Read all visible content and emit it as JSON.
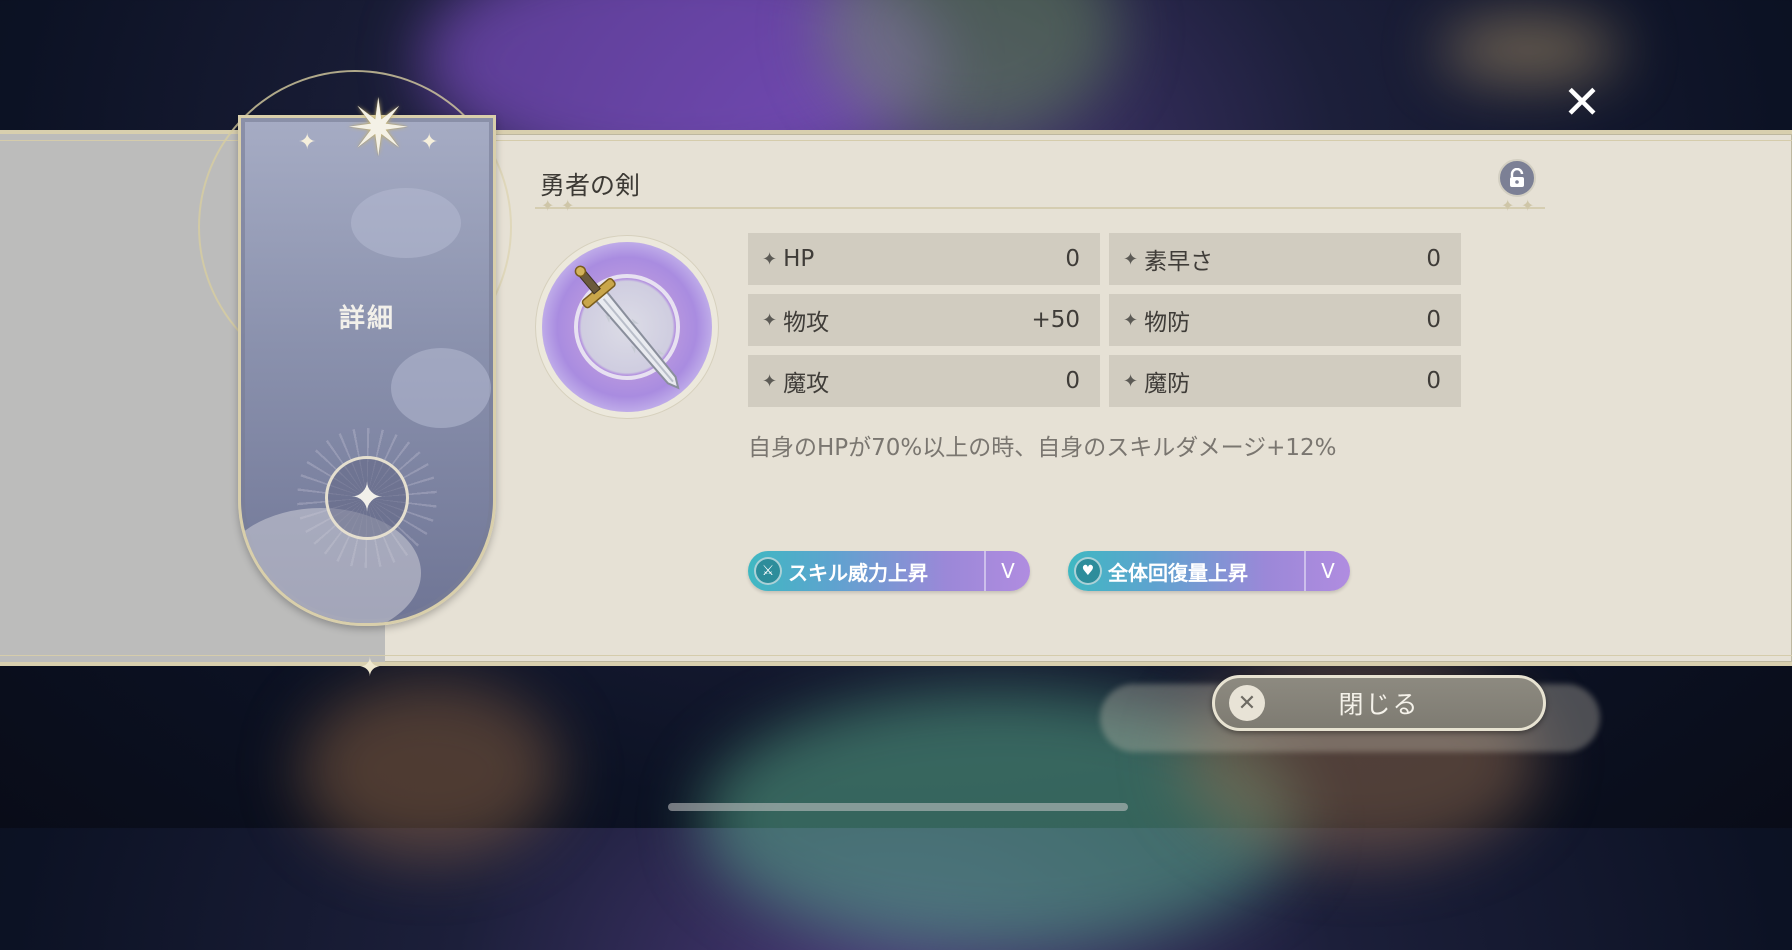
{
  "header": {
    "close_icon": "close-icon",
    "blurred_currency_present": true
  },
  "side_card": {
    "title": "詳細",
    "icons": [
      "eight-point-star-icon",
      "four-point-star-icon",
      "sparkle-icon"
    ]
  },
  "item": {
    "name": "勇者の剣",
    "lock_icon": "unlocked-padlock-icon",
    "image_icon": "sword-icon",
    "description": "自身のHPが70%以上の時、自身のスキルダメージ+12%"
  },
  "stats": [
    {
      "label": "HP",
      "value": "0"
    },
    {
      "label": "素早さ",
      "value": "0"
    },
    {
      "label": "物攻",
      "value": "+50"
    },
    {
      "label": "物防",
      "value": "0"
    },
    {
      "label": "魔攻",
      "value": "0"
    },
    {
      "label": "魔防",
      "value": "0"
    }
  ],
  "tags": [
    {
      "label": "スキル威力上昇",
      "level": "V",
      "icon": "sword-skill-icon"
    },
    {
      "label": "全体回復量上昇",
      "level": "V",
      "icon": "heart-heal-icon"
    }
  ],
  "footer": {
    "close_label": "閉じる",
    "close_icon": "close-icon"
  },
  "colors": {
    "panel": "#e6e1d5",
    "card": "#8a91ad",
    "tag_gradient_start": "#3fb8c2",
    "tag_gradient_end": "#b08ce0"
  }
}
